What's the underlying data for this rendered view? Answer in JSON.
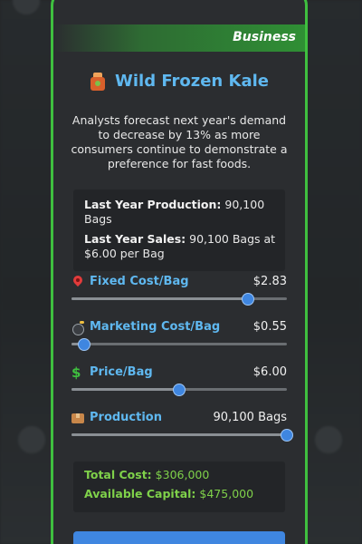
{
  "modal": {
    "banner": "Business",
    "product_name": "Wild Frozen Kale",
    "description": "Analysts forecast next year's demand to decrease by 13% as more consumers continue to demonstrate a preference for fast foods.",
    "last_year_production_label": "Last Year Production:",
    "last_year_production_value": "90,100 Bags",
    "last_year_sales_label": "Last Year Sales:",
    "last_year_sales_value": "90,100 Bags at $6.00 per Bag",
    "sliders": [
      {
        "icon": "pin-icon",
        "label": "Fixed Cost/Bag",
        "value": "$2.83",
        "level": 0.82
      },
      {
        "icon": "bomb-icon",
        "label": "Marketing Cost/Bag",
        "value": "$0.55",
        "level": 0.06
      },
      {
        "icon": "dollar-icon",
        "label": "Price/Bag",
        "value": "$6.00",
        "level": 0.5
      },
      {
        "icon": "box-icon",
        "label": "Production",
        "value": "90,100 Bags",
        "level": 1.0
      }
    ],
    "total_cost_label": "Total Cost:",
    "total_cost_value": "$306,000",
    "available_capital_label": "Available Capital:",
    "available_capital_value": "$475,000"
  },
  "colors": {
    "accent_green": "#3fbf3f",
    "label_blue": "#5fb8f0",
    "thumb_blue": "#3f86e0",
    "total_green": "#7fd14a"
  }
}
